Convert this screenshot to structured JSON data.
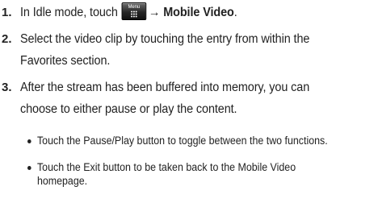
{
  "steps": [
    {
      "number": "1.",
      "text_before": "In Idle mode, touch",
      "key_label": "Menu",
      "key_icon": "menu-grid-icon",
      "arrow": "→",
      "bold_text": "Mobile Video",
      "text_after": "."
    },
    {
      "number": "2.",
      "lines": [
        "Select the video clip by touching the entry from within the",
        "Favorites section."
      ]
    },
    {
      "number": "3.",
      "lines": [
        "After the stream has been buffered into memory, you can",
        "choose to either pause or play the content."
      ]
    }
  ],
  "bullets": [
    {
      "lines": [
        "Touch the Pause/Play button to toggle between the two functions."
      ]
    },
    {
      "lines": [
        "Touch the Exit button to be taken back to the Mobile Video",
        "homepage."
      ]
    }
  ]
}
